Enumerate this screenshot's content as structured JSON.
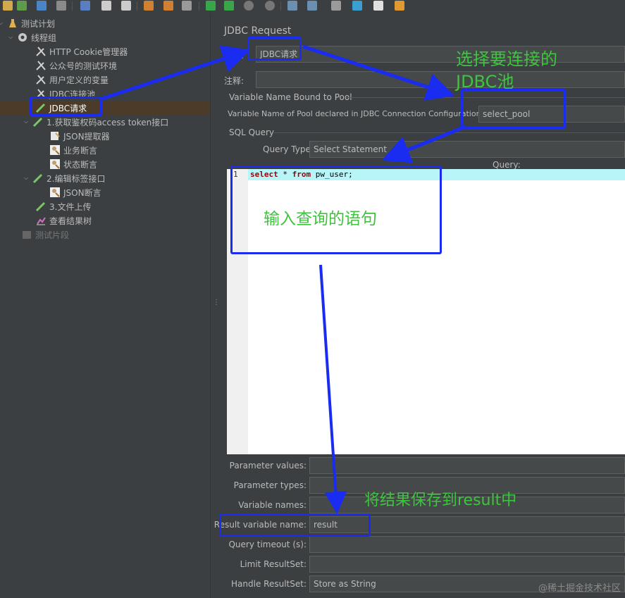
{
  "tree": {
    "items": [
      {
        "label": "测试计划",
        "icon": "flask-icon"
      },
      {
        "label": "线程组",
        "icon": "gear-icon"
      },
      {
        "label": "HTTP Cookie管理器",
        "icon": "wrench-icon"
      },
      {
        "label": "公众号的测试环境",
        "icon": "wrench-icon"
      },
      {
        "label": "用户定义的变量",
        "icon": "wrench-icon"
      },
      {
        "label": "JDBC连接池",
        "icon": "wrench-icon"
      },
      {
        "label": "JDBC请求",
        "icon": "pipette-icon"
      },
      {
        "label": "1.获取鉴权码access token接口",
        "icon": "pipette-icon"
      },
      {
        "label": "JSON提取器",
        "icon": "extractor-icon"
      },
      {
        "label": "业务断言",
        "icon": "assertion-icon"
      },
      {
        "label": "状态断言",
        "icon": "assertion-icon"
      },
      {
        "label": "2.编辑标签接口",
        "icon": "pipette-icon"
      },
      {
        "label": "JSON断言",
        "icon": "assertion-icon"
      },
      {
        "label": "3.文件上传",
        "icon": "pipette-icon"
      },
      {
        "label": "查看结果树",
        "icon": "chart-icon"
      },
      {
        "label": "测试片段",
        "icon": "fragment-icon"
      }
    ]
  },
  "panel": {
    "title": "JDBC Request",
    "name_label": "名称:",
    "name_value": "JDBC请求",
    "comment_label": "注释:",
    "comment_value": "",
    "pool_group_title": "Variable Name Bound to Pool",
    "pool_label": "Variable Name of Pool declared in JDBC Connection Configuration:",
    "pool_value": "select_pool",
    "sql_group_title": "SQL Query",
    "query_type_label": "Query Type:",
    "query_type_value": "Select Statement",
    "query_label": "Query:",
    "line_number": "1",
    "code": {
      "kw1": "select",
      "mid": " * ",
      "kw2": "from",
      "rest": " pw_user;"
    },
    "params": [
      {
        "label": "Parameter values:",
        "value": ""
      },
      {
        "label": "Parameter types:",
        "value": ""
      },
      {
        "label": "Variable names:",
        "value": ""
      },
      {
        "label": "Result variable name:",
        "value": "result"
      },
      {
        "label": "Query timeout (s):",
        "value": ""
      },
      {
        "label": "Limit ResultSet:",
        "value": ""
      },
      {
        "label": "Handle ResultSet:",
        "value": "Store as String"
      }
    ]
  },
  "annotations": {
    "pool_hint_line1": "选择要连接的",
    "pool_hint_line2": "JDBC池",
    "query_hint": "输入查询的语句",
    "result_hint": "将结果保存到result中",
    "color": "#1a2cf0",
    "text_color": "#3ec43e"
  },
  "watermark": "@稀土掘金技术社区"
}
